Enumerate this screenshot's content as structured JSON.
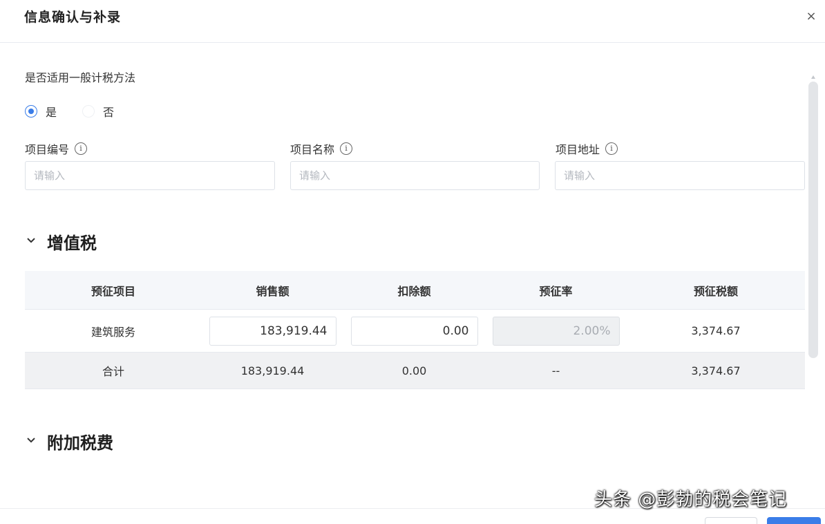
{
  "dialog": {
    "title": "信息确认与补录",
    "close_label": "×"
  },
  "method": {
    "question": "是否适用一般计税方法",
    "options": [
      {
        "label": "是",
        "selected": true
      },
      {
        "label": "否",
        "selected": false
      }
    ]
  },
  "fields": [
    {
      "label": "项目编号",
      "placeholder": "请输入",
      "value": ""
    },
    {
      "label": "项目名称",
      "placeholder": "请输入",
      "value": ""
    },
    {
      "label": "项目地址",
      "placeholder": "请输入",
      "value": ""
    }
  ],
  "vat": {
    "section_title": "增值税",
    "columns": [
      "预征项目",
      "销售额",
      "扣除额",
      "预征率",
      "预征税额"
    ],
    "rows": [
      {
        "item": "建筑服务",
        "sales": "183,919.44",
        "deduction": "0.00",
        "rate": "2.00%",
        "tax": "3,374.67"
      }
    ],
    "total": {
      "label": "合计",
      "sales": "183,919.44",
      "deduction": "0.00",
      "rate": "--",
      "tax": "3,374.67"
    }
  },
  "surcharge": {
    "section_title": "附加税费"
  },
  "watermark": "头条 @彭勃的税会笔记",
  "colors": {
    "accent": "#3a7de8",
    "border": "#dde1e7",
    "table_header_bg": "#f5f7fa",
    "total_row_bg": "#f0f1f3"
  }
}
